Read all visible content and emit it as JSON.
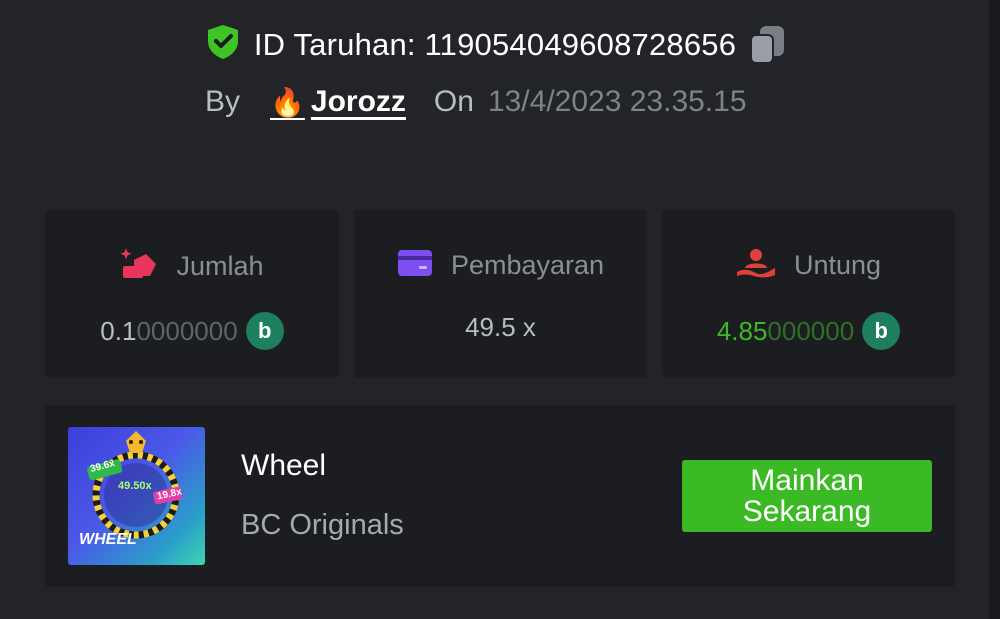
{
  "bet": {
    "id_text": "ID Taruhan: 119054049608728656",
    "by_label": "By",
    "username": "Jorozz",
    "user_emoji": "🔥",
    "on_label": "On",
    "date": "13/4/2023 23.35.15"
  },
  "stats": {
    "amount": {
      "label": "Jumlah",
      "value_main": "0.1",
      "value_trail": "0000000",
      "currency_icon": "bc-coin-icon"
    },
    "payout": {
      "label": "Pembayaran",
      "value": "49.5 x"
    },
    "profit": {
      "label": "Untung",
      "value_main": "4.85",
      "value_trail": "000000",
      "currency_icon": "bc-coin-icon"
    }
  },
  "game": {
    "name": "Wheel",
    "provider": "BC Originals",
    "thumb_title": "WHEEL",
    "thumb_tags": [
      "39.6x",
      "49.50x",
      "19.8x"
    ],
    "play_label": "Mainkan Sekarang"
  },
  "colors": {
    "background": "#232428",
    "card": "#1c1d21",
    "accent_green": "#3cba26",
    "profit_green": "#3cba26",
    "coin": "#1e7f5f",
    "amount_icon": "#e8365b",
    "payout_icon": "#7e4ff0",
    "profit_icon": "#e0403a"
  }
}
